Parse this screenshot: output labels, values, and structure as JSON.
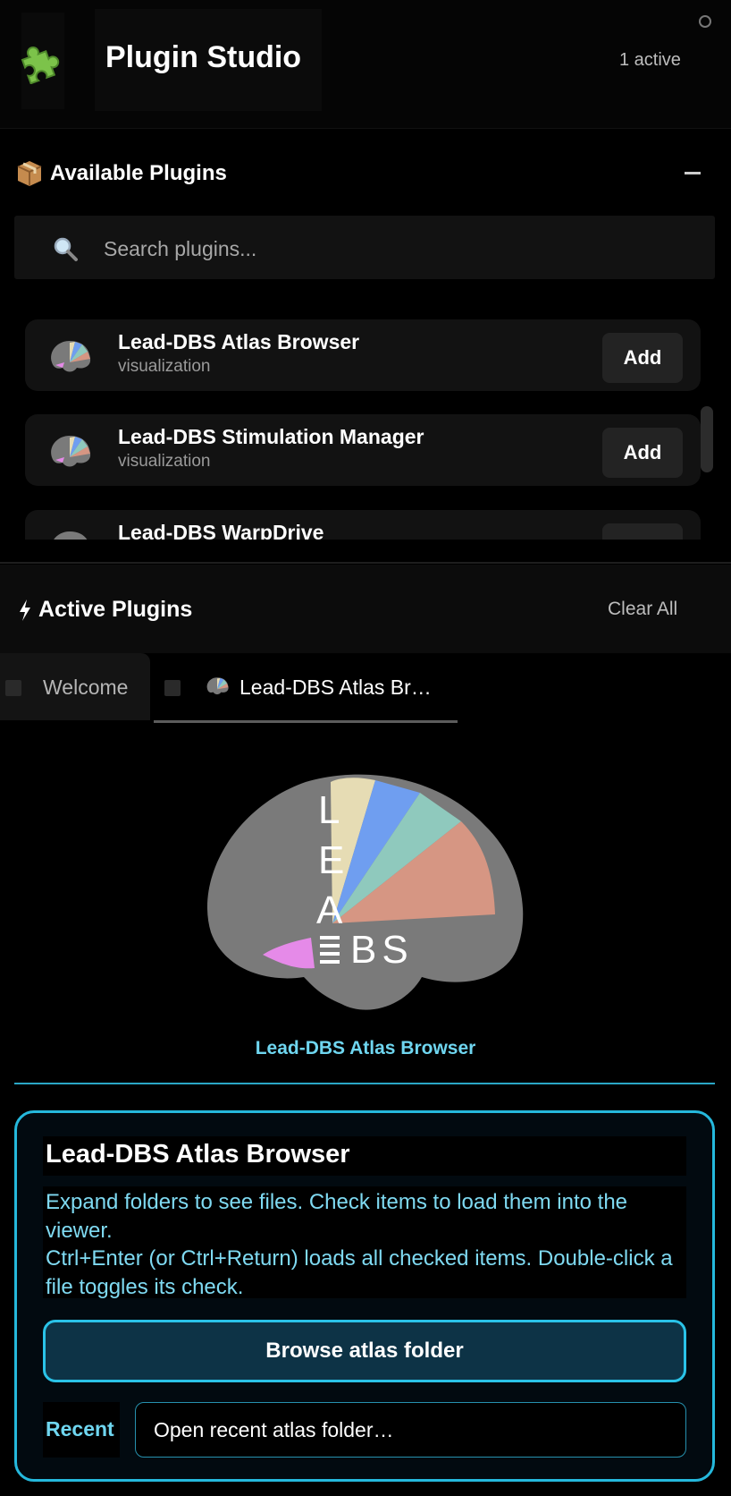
{
  "header": {
    "title": "Plugin Studio",
    "active_count": "1 active",
    "logo_icon": "puzzle-piece-icon",
    "status_icon": "circle-icon"
  },
  "available": {
    "icon": "package-icon",
    "title": "Available Plugins",
    "collapse_icon": "minus-icon",
    "search": {
      "placeholder": "Search plugins...",
      "icon": "magnifier-icon"
    },
    "plugins": [
      {
        "name": "Lead-DBS Atlas Browser",
        "category": "visualization",
        "button": "Add"
      },
      {
        "name": "Lead-DBS Stimulation Manager",
        "category": "visualization",
        "button": "Add"
      },
      {
        "name": "Lead-DBS WarpDrive",
        "category": "",
        "button": ""
      }
    ]
  },
  "active": {
    "icon": "lightning-icon",
    "title": "Active Plugins",
    "clear_label": "Clear All",
    "tabs": [
      {
        "label": "Welcome"
      },
      {
        "label": "Lead-DBS Atlas Br…"
      }
    ]
  },
  "panel": {
    "logo_text": {
      "l": "L",
      "e": "E",
      "a": "A",
      "bs": "BS"
    },
    "caption": "Lead-DBS Atlas Browser",
    "card": {
      "title": "Lead-DBS Atlas Browser",
      "desc_line1": "Expand folders to see files. Check items to load them into the viewer.",
      "desc_line2": "Ctrl+Enter (or Ctrl+Return) loads all checked items. Double-click a file toggles its check.",
      "browse_label": "Browse atlas folder",
      "recent_label": "Recent",
      "recent_select_text": "Open recent atlas folder…"
    }
  },
  "colors": {
    "accent_cyan": "#25b8dc",
    "caption_cyan": "#6fd6f0",
    "brain_gray": "#7a7a7a",
    "wedge_beige": "#e6dcb4",
    "wedge_blue": "#6f9ef0",
    "wedge_teal": "#8fc9bd",
    "wedge_salmon": "#d69683",
    "wedge_pink": "#e58ae8"
  }
}
